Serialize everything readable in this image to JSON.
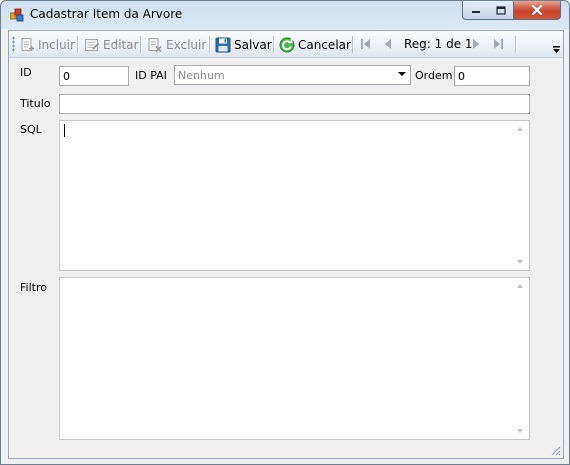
{
  "window": {
    "title": "Cadastrar Item da Arvore"
  },
  "toolbar": {
    "incluir": "Incluir",
    "editar": "Editar",
    "excluir": "Excluir",
    "salvar": "Salvar",
    "cancelar": "Cancelar",
    "record_position": "Reg: 1 de 1"
  },
  "form": {
    "id_label": "ID",
    "id_value": "0",
    "id_pai_label": "ID PAI",
    "id_pai_value": "Nenhum",
    "ordem_label": "Ordem",
    "ordem_value": "0",
    "titulo_label": "Titulo",
    "titulo_value": "",
    "sql_label": "SQL",
    "sql_value": "",
    "filtro_label": "Filtro",
    "filtro_value": ""
  },
  "icons": {
    "app": "app-icon",
    "incluir": "add-document-icon",
    "editar": "edit-icon",
    "excluir": "delete-icon",
    "salvar": "save-icon",
    "cancelar": "refresh-cancel-icon",
    "first": "first-record-icon",
    "prev": "previous-record-icon",
    "next": "next-record-icon",
    "last": "last-record-icon"
  },
  "colors": {
    "close_button": "#c7432a",
    "cancel_icon": "#3aa13a",
    "save_icon": "#2f6fb5"
  }
}
